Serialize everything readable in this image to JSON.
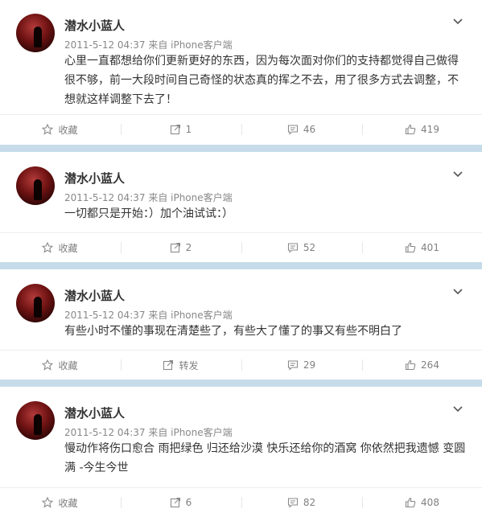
{
  "posts": [
    {
      "username": "潜水小蓝人",
      "meta": "2011-5-12 04:37 来自 iPhone客户端",
      "content": "心里一直都想给你们更新更好的东西，因为每次面对你们的支持都觉得自己做得很不够，前一大段时间自己奇怪的状态真的挥之不去，用了很多方式去调整，不想就这样调整下去了！",
      "collect": "收藏",
      "repost": "1",
      "comment": "46",
      "like": "419"
    },
    {
      "username": "潜水小蓝人",
      "meta": "2011-5-12 04:37 来自 iPhone客户端",
      "content": "一切都只是开始：）加个油试试：）",
      "collect": "收藏",
      "repost": "2",
      "comment": "52",
      "like": "401"
    },
    {
      "username": "潜水小蓝人",
      "meta": "2011-5-12 04:37 来自 iPhone客户端",
      "content": "有些小时不懂的事现在清楚些了，有些大了懂了的事又有些不明白了",
      "collect": "收藏",
      "repost": "转发",
      "comment": "29",
      "like": "264"
    },
    {
      "username": "潜水小蓝人",
      "meta": "2011-5-12 04:37 来自 iPhone客户端",
      "content": "慢动作将伤口愈合 雨把绿色 归还给沙漠 快乐还给你的酒窝 你依然把我遗憾 变圆满 -今生今世",
      "collect": "收藏",
      "repost": "6",
      "comment": "82",
      "like": "408"
    }
  ],
  "colors": {
    "divider": "#c7dcea",
    "text": "#333333",
    "meta": "#888888",
    "action": "#808080"
  },
  "icons": [
    "chevron-down-icon",
    "star-icon",
    "repost-icon",
    "comment-icon",
    "like-icon"
  ]
}
